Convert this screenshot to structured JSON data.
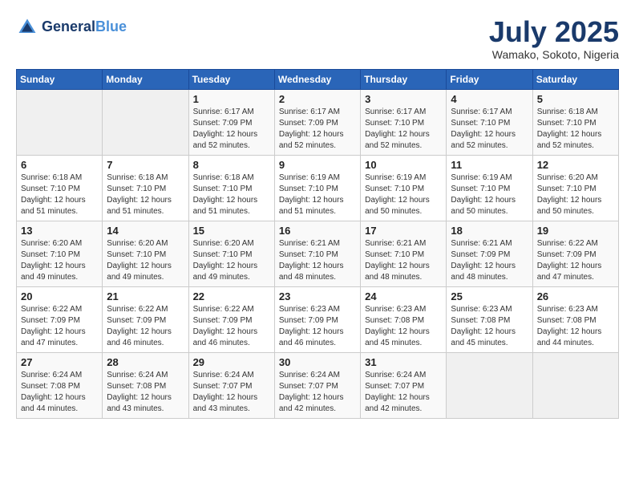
{
  "header": {
    "logo_general": "General",
    "logo_blue": "Blue",
    "month": "July 2025",
    "location": "Wamako, Sokoto, Nigeria"
  },
  "days_of_week": [
    "Sunday",
    "Monday",
    "Tuesday",
    "Wednesday",
    "Thursday",
    "Friday",
    "Saturday"
  ],
  "weeks": [
    [
      {
        "day": "",
        "info": ""
      },
      {
        "day": "",
        "info": ""
      },
      {
        "day": "1",
        "info": "Sunrise: 6:17 AM\nSunset: 7:09 PM\nDaylight: 12 hours and 52 minutes."
      },
      {
        "day": "2",
        "info": "Sunrise: 6:17 AM\nSunset: 7:09 PM\nDaylight: 12 hours and 52 minutes."
      },
      {
        "day": "3",
        "info": "Sunrise: 6:17 AM\nSunset: 7:10 PM\nDaylight: 12 hours and 52 minutes."
      },
      {
        "day": "4",
        "info": "Sunrise: 6:17 AM\nSunset: 7:10 PM\nDaylight: 12 hours and 52 minutes."
      },
      {
        "day": "5",
        "info": "Sunrise: 6:18 AM\nSunset: 7:10 PM\nDaylight: 12 hours and 52 minutes."
      }
    ],
    [
      {
        "day": "6",
        "info": "Sunrise: 6:18 AM\nSunset: 7:10 PM\nDaylight: 12 hours and 51 minutes."
      },
      {
        "day": "7",
        "info": "Sunrise: 6:18 AM\nSunset: 7:10 PM\nDaylight: 12 hours and 51 minutes."
      },
      {
        "day": "8",
        "info": "Sunrise: 6:18 AM\nSunset: 7:10 PM\nDaylight: 12 hours and 51 minutes."
      },
      {
        "day": "9",
        "info": "Sunrise: 6:19 AM\nSunset: 7:10 PM\nDaylight: 12 hours and 51 minutes."
      },
      {
        "day": "10",
        "info": "Sunrise: 6:19 AM\nSunset: 7:10 PM\nDaylight: 12 hours and 50 minutes."
      },
      {
        "day": "11",
        "info": "Sunrise: 6:19 AM\nSunset: 7:10 PM\nDaylight: 12 hours and 50 minutes."
      },
      {
        "day": "12",
        "info": "Sunrise: 6:20 AM\nSunset: 7:10 PM\nDaylight: 12 hours and 50 minutes."
      }
    ],
    [
      {
        "day": "13",
        "info": "Sunrise: 6:20 AM\nSunset: 7:10 PM\nDaylight: 12 hours and 49 minutes."
      },
      {
        "day": "14",
        "info": "Sunrise: 6:20 AM\nSunset: 7:10 PM\nDaylight: 12 hours and 49 minutes."
      },
      {
        "day": "15",
        "info": "Sunrise: 6:20 AM\nSunset: 7:10 PM\nDaylight: 12 hours and 49 minutes."
      },
      {
        "day": "16",
        "info": "Sunrise: 6:21 AM\nSunset: 7:10 PM\nDaylight: 12 hours and 48 minutes."
      },
      {
        "day": "17",
        "info": "Sunrise: 6:21 AM\nSunset: 7:10 PM\nDaylight: 12 hours and 48 minutes."
      },
      {
        "day": "18",
        "info": "Sunrise: 6:21 AM\nSunset: 7:09 PM\nDaylight: 12 hours and 48 minutes."
      },
      {
        "day": "19",
        "info": "Sunrise: 6:22 AM\nSunset: 7:09 PM\nDaylight: 12 hours and 47 minutes."
      }
    ],
    [
      {
        "day": "20",
        "info": "Sunrise: 6:22 AM\nSunset: 7:09 PM\nDaylight: 12 hours and 47 minutes."
      },
      {
        "day": "21",
        "info": "Sunrise: 6:22 AM\nSunset: 7:09 PM\nDaylight: 12 hours and 46 minutes."
      },
      {
        "day": "22",
        "info": "Sunrise: 6:22 AM\nSunset: 7:09 PM\nDaylight: 12 hours and 46 minutes."
      },
      {
        "day": "23",
        "info": "Sunrise: 6:23 AM\nSunset: 7:09 PM\nDaylight: 12 hours and 46 minutes."
      },
      {
        "day": "24",
        "info": "Sunrise: 6:23 AM\nSunset: 7:08 PM\nDaylight: 12 hours and 45 minutes."
      },
      {
        "day": "25",
        "info": "Sunrise: 6:23 AM\nSunset: 7:08 PM\nDaylight: 12 hours and 45 minutes."
      },
      {
        "day": "26",
        "info": "Sunrise: 6:23 AM\nSunset: 7:08 PM\nDaylight: 12 hours and 44 minutes."
      }
    ],
    [
      {
        "day": "27",
        "info": "Sunrise: 6:24 AM\nSunset: 7:08 PM\nDaylight: 12 hours and 44 minutes."
      },
      {
        "day": "28",
        "info": "Sunrise: 6:24 AM\nSunset: 7:08 PM\nDaylight: 12 hours and 43 minutes."
      },
      {
        "day": "29",
        "info": "Sunrise: 6:24 AM\nSunset: 7:07 PM\nDaylight: 12 hours and 43 minutes."
      },
      {
        "day": "30",
        "info": "Sunrise: 6:24 AM\nSunset: 7:07 PM\nDaylight: 12 hours and 42 minutes."
      },
      {
        "day": "31",
        "info": "Sunrise: 6:24 AM\nSunset: 7:07 PM\nDaylight: 12 hours and 42 minutes."
      },
      {
        "day": "",
        "info": ""
      },
      {
        "day": "",
        "info": ""
      }
    ]
  ]
}
